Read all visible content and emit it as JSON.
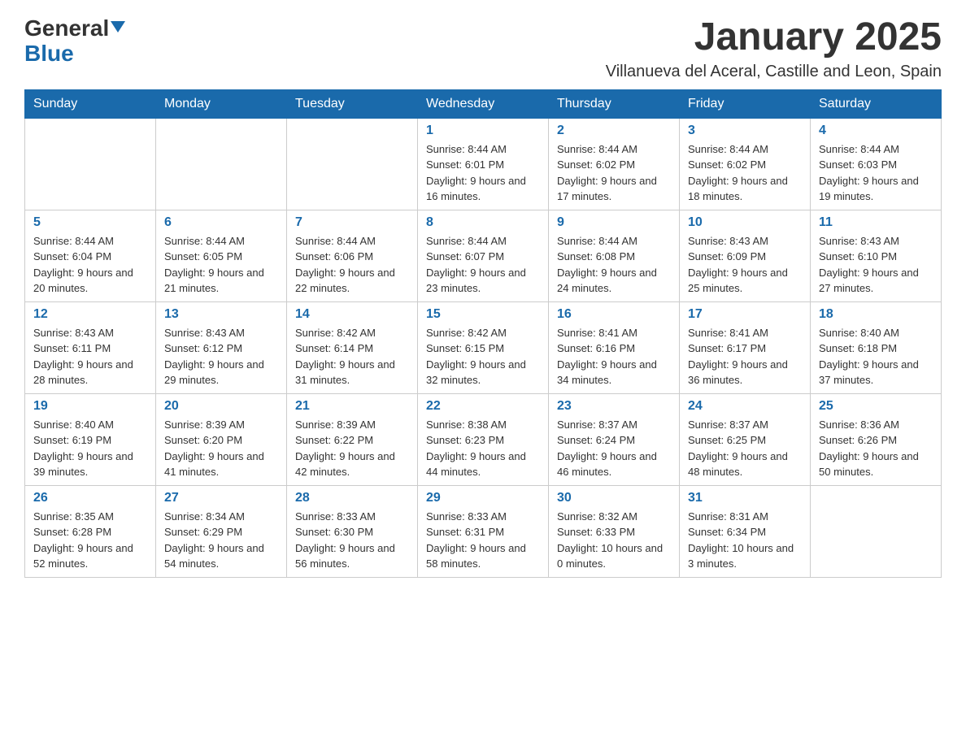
{
  "header": {
    "logo_general": "General",
    "logo_blue": "Blue",
    "title": "January 2025",
    "subtitle": "Villanueva del Aceral, Castille and Leon, Spain"
  },
  "days_of_week": [
    "Sunday",
    "Monday",
    "Tuesday",
    "Wednesday",
    "Thursday",
    "Friday",
    "Saturday"
  ],
  "weeks": [
    [
      {
        "day": "",
        "info": ""
      },
      {
        "day": "",
        "info": ""
      },
      {
        "day": "",
        "info": ""
      },
      {
        "day": "1",
        "info": "Sunrise: 8:44 AM\nSunset: 6:01 PM\nDaylight: 9 hours and 16 minutes."
      },
      {
        "day": "2",
        "info": "Sunrise: 8:44 AM\nSunset: 6:02 PM\nDaylight: 9 hours and 17 minutes."
      },
      {
        "day": "3",
        "info": "Sunrise: 8:44 AM\nSunset: 6:02 PM\nDaylight: 9 hours and 18 minutes."
      },
      {
        "day": "4",
        "info": "Sunrise: 8:44 AM\nSunset: 6:03 PM\nDaylight: 9 hours and 19 minutes."
      }
    ],
    [
      {
        "day": "5",
        "info": "Sunrise: 8:44 AM\nSunset: 6:04 PM\nDaylight: 9 hours and 20 minutes."
      },
      {
        "day": "6",
        "info": "Sunrise: 8:44 AM\nSunset: 6:05 PM\nDaylight: 9 hours and 21 minutes."
      },
      {
        "day": "7",
        "info": "Sunrise: 8:44 AM\nSunset: 6:06 PM\nDaylight: 9 hours and 22 minutes."
      },
      {
        "day": "8",
        "info": "Sunrise: 8:44 AM\nSunset: 6:07 PM\nDaylight: 9 hours and 23 minutes."
      },
      {
        "day": "9",
        "info": "Sunrise: 8:44 AM\nSunset: 6:08 PM\nDaylight: 9 hours and 24 minutes."
      },
      {
        "day": "10",
        "info": "Sunrise: 8:43 AM\nSunset: 6:09 PM\nDaylight: 9 hours and 25 minutes."
      },
      {
        "day": "11",
        "info": "Sunrise: 8:43 AM\nSunset: 6:10 PM\nDaylight: 9 hours and 27 minutes."
      }
    ],
    [
      {
        "day": "12",
        "info": "Sunrise: 8:43 AM\nSunset: 6:11 PM\nDaylight: 9 hours and 28 minutes."
      },
      {
        "day": "13",
        "info": "Sunrise: 8:43 AM\nSunset: 6:12 PM\nDaylight: 9 hours and 29 minutes."
      },
      {
        "day": "14",
        "info": "Sunrise: 8:42 AM\nSunset: 6:14 PM\nDaylight: 9 hours and 31 minutes."
      },
      {
        "day": "15",
        "info": "Sunrise: 8:42 AM\nSunset: 6:15 PM\nDaylight: 9 hours and 32 minutes."
      },
      {
        "day": "16",
        "info": "Sunrise: 8:41 AM\nSunset: 6:16 PM\nDaylight: 9 hours and 34 minutes."
      },
      {
        "day": "17",
        "info": "Sunrise: 8:41 AM\nSunset: 6:17 PM\nDaylight: 9 hours and 36 minutes."
      },
      {
        "day": "18",
        "info": "Sunrise: 8:40 AM\nSunset: 6:18 PM\nDaylight: 9 hours and 37 minutes."
      }
    ],
    [
      {
        "day": "19",
        "info": "Sunrise: 8:40 AM\nSunset: 6:19 PM\nDaylight: 9 hours and 39 minutes."
      },
      {
        "day": "20",
        "info": "Sunrise: 8:39 AM\nSunset: 6:20 PM\nDaylight: 9 hours and 41 minutes."
      },
      {
        "day": "21",
        "info": "Sunrise: 8:39 AM\nSunset: 6:22 PM\nDaylight: 9 hours and 42 minutes."
      },
      {
        "day": "22",
        "info": "Sunrise: 8:38 AM\nSunset: 6:23 PM\nDaylight: 9 hours and 44 minutes."
      },
      {
        "day": "23",
        "info": "Sunrise: 8:37 AM\nSunset: 6:24 PM\nDaylight: 9 hours and 46 minutes."
      },
      {
        "day": "24",
        "info": "Sunrise: 8:37 AM\nSunset: 6:25 PM\nDaylight: 9 hours and 48 minutes."
      },
      {
        "day": "25",
        "info": "Sunrise: 8:36 AM\nSunset: 6:26 PM\nDaylight: 9 hours and 50 minutes."
      }
    ],
    [
      {
        "day": "26",
        "info": "Sunrise: 8:35 AM\nSunset: 6:28 PM\nDaylight: 9 hours and 52 minutes."
      },
      {
        "day": "27",
        "info": "Sunrise: 8:34 AM\nSunset: 6:29 PM\nDaylight: 9 hours and 54 minutes."
      },
      {
        "day": "28",
        "info": "Sunrise: 8:33 AM\nSunset: 6:30 PM\nDaylight: 9 hours and 56 minutes."
      },
      {
        "day": "29",
        "info": "Sunrise: 8:33 AM\nSunset: 6:31 PM\nDaylight: 9 hours and 58 minutes."
      },
      {
        "day": "30",
        "info": "Sunrise: 8:32 AM\nSunset: 6:33 PM\nDaylight: 10 hours and 0 minutes."
      },
      {
        "day": "31",
        "info": "Sunrise: 8:31 AM\nSunset: 6:34 PM\nDaylight: 10 hours and 3 minutes."
      },
      {
        "day": "",
        "info": ""
      }
    ]
  ]
}
